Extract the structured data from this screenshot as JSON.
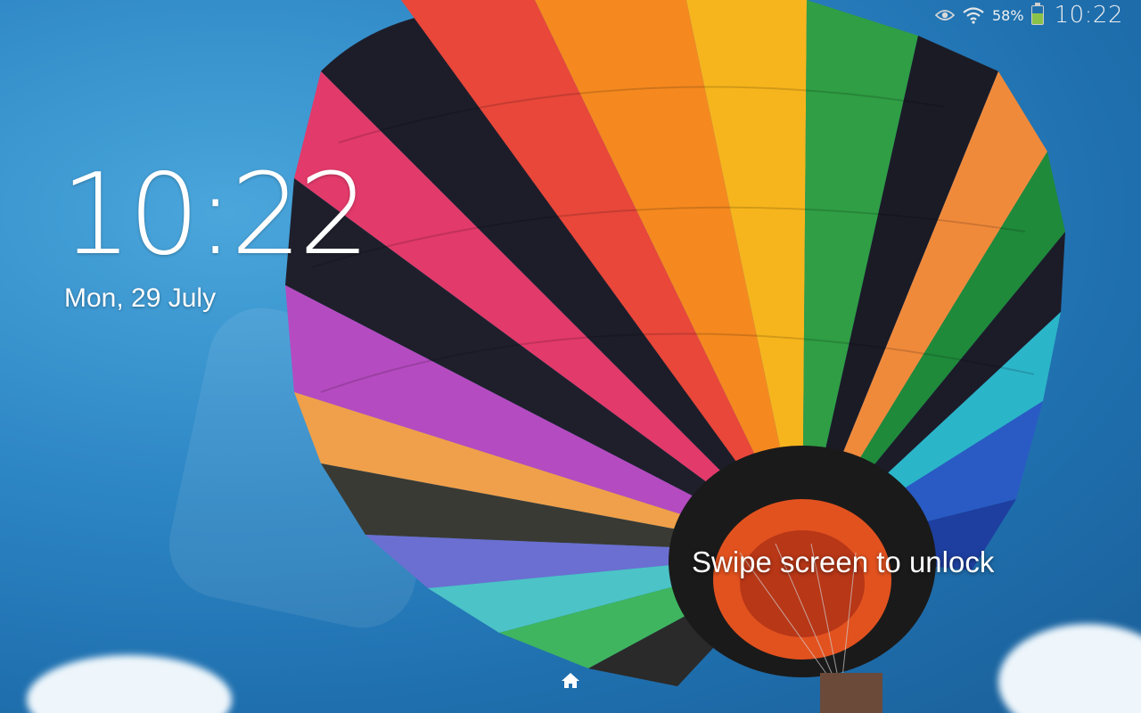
{
  "status_bar": {
    "icons": [
      "smart-stay-eye-icon",
      "wifi-icon",
      "battery-icon"
    ],
    "battery_percent": "58%",
    "battery_level": 0.58,
    "time": "10:22"
  },
  "lockscreen": {
    "clock": "10:22",
    "date": "Mon, 29 July",
    "unlock_hint": "Swipe screen to unlock"
  },
  "navigation": {
    "home_icon": "home-icon"
  },
  "colors": {
    "sky": "#2d86c4",
    "battery_fill": "#8bc34a",
    "text": "#ffffff"
  }
}
